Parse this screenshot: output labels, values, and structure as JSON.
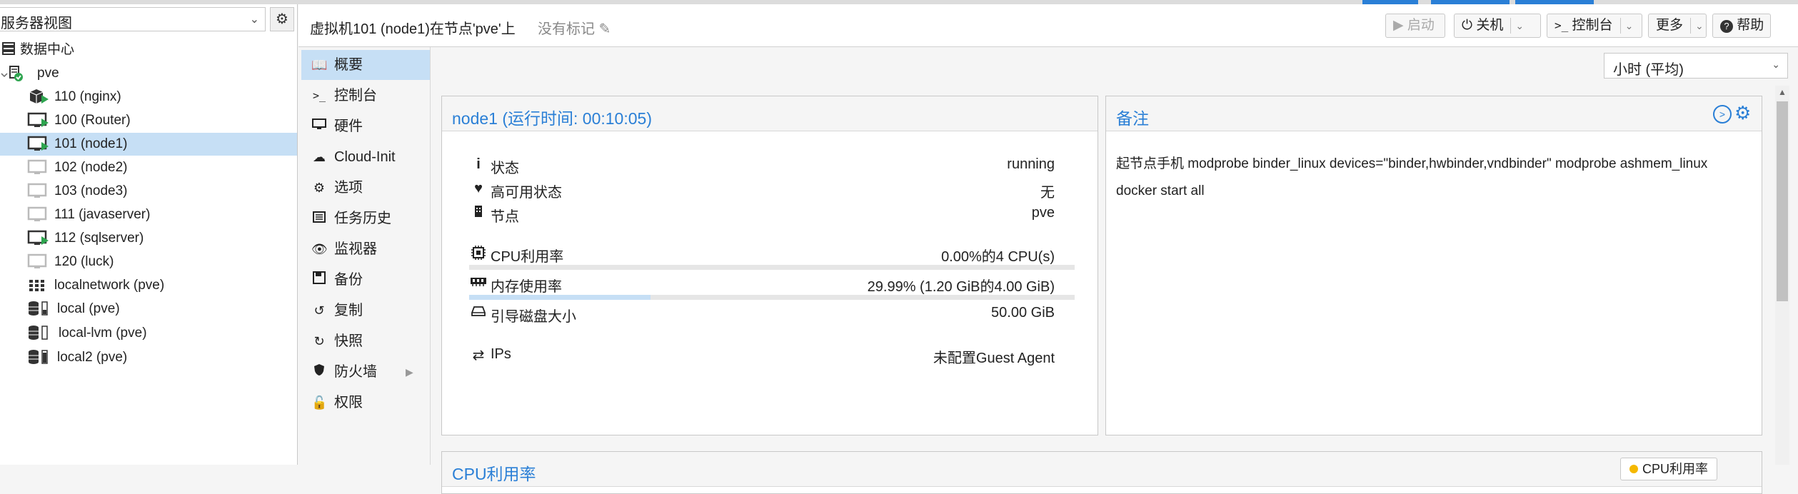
{
  "tree": {
    "view_label": "服务器视图",
    "rows": [
      {
        "label": "数据中心",
        "icon": "datacenter-icon"
      },
      {
        "label": "pve",
        "icon": "node-icon"
      },
      {
        "label": "110 (nginx)",
        "icon": "container-running-icon"
      },
      {
        "label": "100 (Router)",
        "icon": "vm-running-icon"
      },
      {
        "label": "101 (node1)",
        "icon": "vm-running-icon"
      },
      {
        "label": "102 (node2)",
        "icon": "vm-stopped-icon"
      },
      {
        "label": "103 (node3)",
        "icon": "vm-stopped-icon"
      },
      {
        "label": "111 (javaserver)",
        "icon": "vm-stopped-icon"
      },
      {
        "label": "112 (sqlserver)",
        "icon": "vm-running-icon"
      },
      {
        "label": "120 (luck)",
        "icon": "vm-stopped-icon"
      },
      {
        "label": "localnetwork (pve)",
        "icon": "network-icon"
      },
      {
        "label": "local (pve)",
        "icon": "storage-icon"
      },
      {
        "label": "local-lvm (pve)",
        "icon": "storage-icon"
      },
      {
        "label": "local2 (pve)",
        "icon": "storage-icon"
      }
    ]
  },
  "header": {
    "title": "虚拟机101 (node1)在节点'pve'上",
    "tags": "没有标记",
    "buttons": {
      "start": "启动",
      "shutdown": "关机",
      "console": "控制台",
      "more": "更多",
      "help": "帮助"
    }
  },
  "subnav": [
    {
      "label": "概要",
      "icon": "book-icon"
    },
    {
      "label": "控制台",
      "icon": "terminal-icon"
    },
    {
      "label": "硬件",
      "icon": "monitor-icon"
    },
    {
      "label": "Cloud-Init",
      "icon": "cloud-icon"
    },
    {
      "label": "选项",
      "icon": "gear-icon"
    },
    {
      "label": "任务历史",
      "icon": "list-icon"
    },
    {
      "label": "监视器",
      "icon": "eye-icon"
    },
    {
      "label": "备份",
      "icon": "floppy-icon"
    },
    {
      "label": "复制",
      "icon": "retweet-icon"
    },
    {
      "label": "快照",
      "icon": "history-icon"
    },
    {
      "label": "防火墙",
      "icon": "shield-icon"
    },
    {
      "label": "权限",
      "icon": "unlock-icon"
    }
  ],
  "timeframe": "小时 (平均)",
  "status_panel": {
    "title": "node1 (运行时间: 00:10:05)",
    "rows": [
      {
        "label": "状态",
        "value": "running",
        "icon": "info-icon"
      },
      {
        "label": "高可用状态",
        "value": "无",
        "icon": "heartbeat-icon"
      },
      {
        "label": "节点",
        "value": "pve",
        "icon": "building-icon"
      },
      {
        "label": "CPU利用率",
        "value": "0.00%的4 CPU(s)",
        "icon": "cpu-icon"
      },
      {
        "label": "内存使用率",
        "value": "29.99% (1.20 GiB的4.00 GiB)",
        "icon": "memory-icon"
      },
      {
        "label": "引导磁盘大小",
        "value": "50.00 GiB",
        "icon": "hdd-icon"
      },
      {
        "label": "IPs",
        "value": "未配置Guest Agent",
        "icon": "exchange-icon"
      }
    ],
    "cpu_fraction": 0.0,
    "mem_fraction": 0.2999
  },
  "notes_panel": {
    "title": "备注",
    "text": "起节点手机 modprobe binder_linux devices=\"binder,hwbinder,vndbinder\" modprobe ashmem_linux docker start all"
  },
  "cpu_chart_panel": {
    "title": "CPU利用率",
    "legend": "CPU利用率"
  },
  "colors": {
    "accent": "#2a7fd6",
    "selected": "#c6dff5",
    "running": "#2ea44f"
  }
}
